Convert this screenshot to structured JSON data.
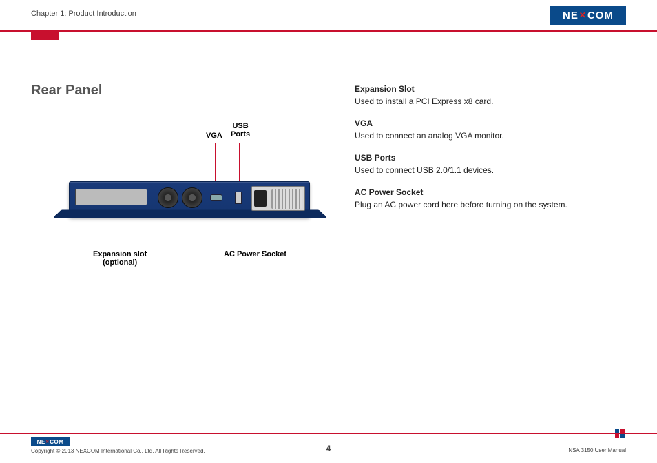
{
  "header": {
    "chapter": "Chapter 1: Product Introduction",
    "logo_pre": "NE",
    "logo_x": "✕",
    "logo_post": "COM"
  },
  "section": {
    "title": "Rear Panel"
  },
  "callouts": {
    "vga": "VGA",
    "usb": "USB\nPorts",
    "expansion": "Expansion slot\n(optional)",
    "ac": "AC Power Socket"
  },
  "descriptions": [
    {
      "title": "Expansion Slot",
      "text": "Used to install a PCI Express x8 card."
    },
    {
      "title": "VGA",
      "text": "Used to connect an analog VGA monitor."
    },
    {
      "title": "USB Ports",
      "text": "Used to connect USB 2.0/1.1 devices."
    },
    {
      "title": "AC Power Socket",
      "text": "Plug an AC power cord here before turning on the system."
    }
  ],
  "footer": {
    "logo_pre": "NE",
    "logo_x": "✕",
    "logo_post": "COM",
    "copyright": "Copyright © 2013 NEXCOM International Co., Ltd. All Rights Reserved.",
    "page": "4",
    "doc": "NSA 3150 User Manual"
  }
}
